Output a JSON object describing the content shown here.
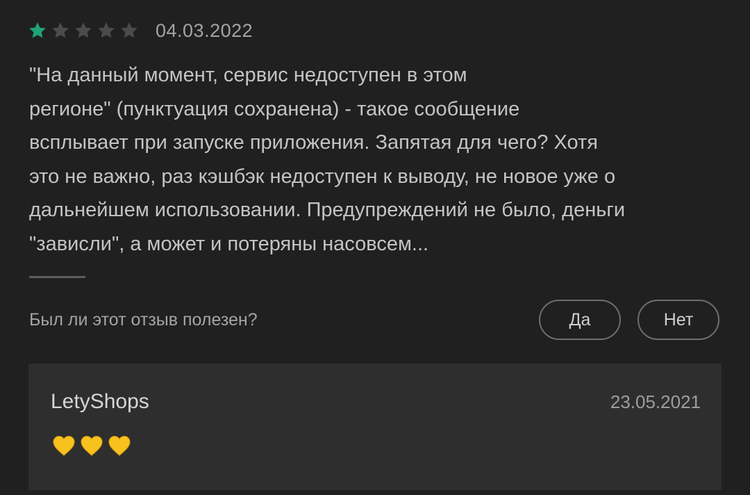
{
  "review": {
    "rating": 1,
    "max_rating": 5,
    "date": "04.03.2022",
    "text": "\"На данный момент, сервис недоступен в этом\nрегионе\" (пунктуация сохранена) - такое сообщение\nвсплывает при запуске приложения. Запятая для чего? Хотя\nэто не важно, раз кэшбэк недоступен к выводу, не новое уже о\nдальнейшем использовании. Предупреждений не было, деньги\n\"зависли\", а может и потеряны насовсем...",
    "helpful_question": "Был ли этот отзыв полезен?",
    "helpful_yes": "Да",
    "helpful_no": "Нет"
  },
  "reply": {
    "author": "LetyShops",
    "date": "23.05.2021",
    "hearts_icon": "yellow-heart-icon",
    "hearts_count": 3
  },
  "colors": {
    "background": "#202020",
    "star_filled": "#1fa37a",
    "star_empty": "#4b4b4b",
    "heart": "#f7c21d",
    "reply_background": "#2e2e2e"
  }
}
